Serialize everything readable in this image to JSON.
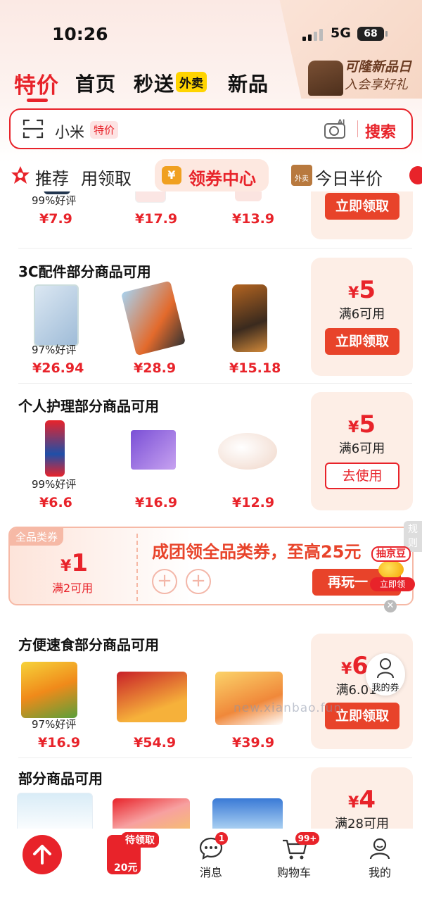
{
  "status": {
    "time": "10:26",
    "network": "5G",
    "battery": "68"
  },
  "nav": {
    "tabs": [
      "特价",
      "首页",
      "秒送",
      "新品"
    ],
    "waimai_badge": "外卖",
    "promo_line1": "可隆新品日",
    "promo_line2": "入会享好礼"
  },
  "search": {
    "query": "小米",
    "tag": "特价",
    "camera_badge": "AI",
    "button": "搜索"
  },
  "categories": {
    "item1": "推荐",
    "item2": "用领取",
    "item3": "领券中心",
    "item4": "今日半价",
    "ticket_glyph": "¥",
    "half_icon_text": "外卖"
  },
  "sections": [
    {
      "products": [
        {
          "rating": "99%好评",
          "price": "¥7.9"
        },
        {
          "price": "¥17.9"
        },
        {
          "price": "¥13.9"
        }
      ],
      "coupon": {
        "button": "立即领取"
      }
    },
    {
      "title": "3C配件部分商品可用",
      "products": [
        {
          "rating": "97%好评",
          "price": "¥26.94"
        },
        {
          "price": "¥28.9"
        },
        {
          "price": "¥15.18"
        }
      ],
      "coupon": {
        "currency": "¥",
        "amount": "5",
        "condition": "满6可用",
        "button": "立即领取"
      }
    },
    {
      "title": "个人护理部分商品可用",
      "products": [
        {
          "rating": "99%好评",
          "price": "¥6.6"
        },
        {
          "price": "¥16.9"
        },
        {
          "price": "¥12.9"
        }
      ],
      "coupon": {
        "currency": "¥",
        "amount": "5",
        "condition": "满6可用",
        "button": "去使用"
      }
    },
    {
      "title": "方便速食部分商品可用",
      "products": [
        {
          "rating": "97%好评",
          "price": "¥16.9"
        },
        {
          "price": "¥54.9"
        },
        {
          "price": "¥39.9"
        }
      ],
      "coupon": {
        "currency": "¥",
        "amount": "6",
        "condition": "满6.01",
        "button": "立即领取"
      }
    },
    {
      "title": "部分商品可用",
      "coupon": {
        "currency": "¥",
        "amount": "4",
        "condition": "满28可用"
      }
    }
  ],
  "banner": {
    "tag": "全品类券",
    "currency": "¥",
    "amount": "1",
    "condition": "满2可用",
    "title": "成团领全品类券，至高25元",
    "button": "再玩一",
    "rules": "规则"
  },
  "floating": {
    "jd_bean": "抽京豆",
    "jd_bean_button": "立即领",
    "my_coupons": "我的券"
  },
  "watermark": "new.xianbao.fun",
  "tabbar": {
    "redpacket_tag": "待领取",
    "redpacket_amount": "20元",
    "messages": "消息",
    "messages_badge": "1",
    "cart": "购物车",
    "cart_badge": "99+",
    "me": "我的"
  },
  "colors": {
    "accent": "#e8232a",
    "coupon_bg": "#fdeee6"
  }
}
